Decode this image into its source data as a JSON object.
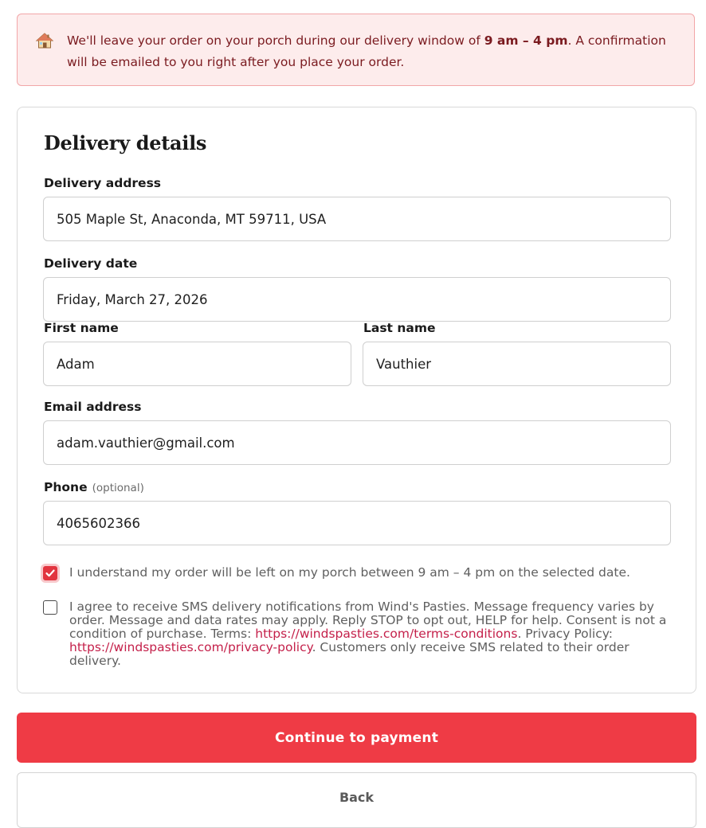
{
  "banner": {
    "icon": "house-icon",
    "text_before": "We'll leave your order on your porch during our delivery window of ",
    "window": "9 am – 4 pm",
    "text_after": ". A confirmation will be emailed to you right after you place your order."
  },
  "delivery": {
    "title": "Delivery details",
    "address_label": "Delivery address",
    "address_value": "505 Maple St, Anaconda, MT 59711, USA",
    "date_label": "Delivery date",
    "date_value": "Friday, March 27, 2026",
    "first_name_label": "First name",
    "first_name_value": "Adam",
    "last_name_label": "Last name",
    "last_name_value": "Vauthier",
    "email_label": "Email address",
    "email_value": "adam.vauthier@gmail.com",
    "phone_label": "Phone",
    "phone_optional": "(optional)",
    "phone_value": "4065602366"
  },
  "consent": {
    "porch_checked": true,
    "porch_text": "I understand my order will be left on my porch between 9 am – 4 pm on the selected date.",
    "sms_checked": false,
    "sms_text_1": "I agree to receive SMS delivery notifications from Wind's Pasties. Message frequency varies by order. Message and data rates may apply. Reply STOP to opt out, HELP for help. Consent is not a condition of purchase. Terms: ",
    "terms_link": "https://windspasties.com/terms-conditions",
    "sms_text_2": ". Privacy Policy: ",
    "privacy_link": "https://windspasties.com/privacy-policy",
    "sms_text_3": ". Customers only receive SMS related to their order delivery."
  },
  "actions": {
    "continue_label": "Continue to payment",
    "back_label": "Back"
  },
  "colors": {
    "accent": "#ef3b45",
    "banner_bg": "#fdecec",
    "banner_text": "#7a1a1f",
    "link": "#c4204a"
  }
}
